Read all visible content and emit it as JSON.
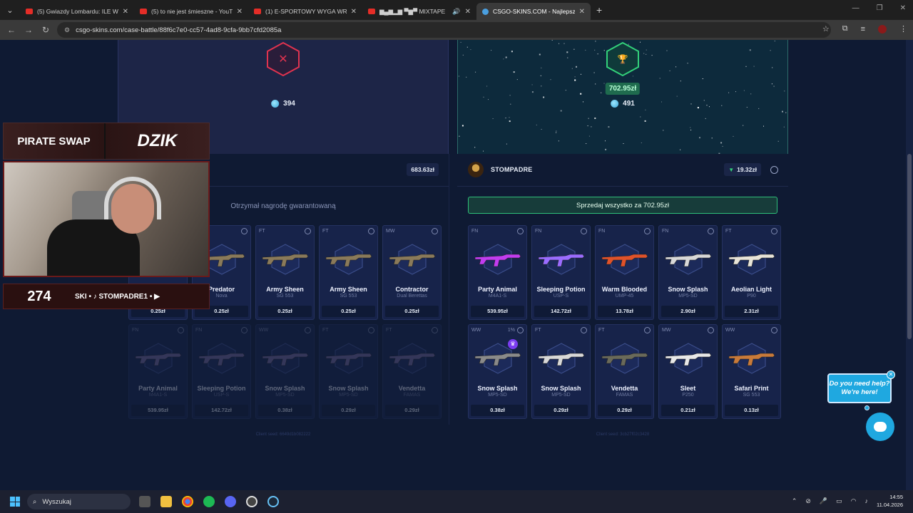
{
  "browser": {
    "tabs": [
      {
        "label": "(5) Gwiazdy Lombardu: ILE WYC",
        "icon": "youtube-icon",
        "active": false
      },
      {
        "label": "(5) to nie jest śmieszne - YouTu",
        "icon": "youtube-icon",
        "active": false
      },
      {
        "label": "(1) E-SPORTOWY WYGA WRAC",
        "icon": "youtube-icon",
        "active": false
      },
      {
        "label": "▆▄▆▂▆ ▀▆▀ MIXTAPE",
        "icon": "youtube-icon",
        "active": false
      },
      {
        "label": "CSGO-SKINS.COM - Najlepsze",
        "icon": "csgo-skins-icon",
        "active": true
      }
    ],
    "url": "csgo-skins.com/case-battle/88f6c7e0-cc57-4ad8-9cfa-9bb7cfd2085a"
  },
  "battle": {
    "left": {
      "result_icon": "x-icon",
      "coins": "394",
      "player_value": "683.63zł",
      "guaranteed_text": "Otrzymał nagrodę gwarantowaną",
      "seed": "Client seed: 6649d1b082222",
      "row1": [
        {
          "cond": "",
          "name": "",
          "type": "",
          "price": "0.25zł"
        },
        {
          "cond": "",
          "name": "Predator",
          "type": "Nova",
          "price": "0.25zł"
        },
        {
          "cond": "FT",
          "name": "Army Sheen",
          "type": "SG 553",
          "price": "0.25zł"
        },
        {
          "cond": "FT",
          "name": "Army Sheen",
          "type": "SG 553",
          "price": "0.25zł"
        },
        {
          "cond": "MW",
          "name": "Contractor",
          "type": "Dual Berettas",
          "price": "0.25zł"
        }
      ],
      "row2": [
        {
          "cond": "FN",
          "name": "Party Animal",
          "type": "M4A1-S",
          "price": "539.95zł"
        },
        {
          "cond": "FN",
          "name": "Sleeping Potion",
          "type": "USP-S",
          "price": "142.72zł"
        },
        {
          "cond": "WW",
          "name": "Snow Splash",
          "type": "MP5-SD",
          "price": "0.38zł"
        },
        {
          "cond": "FT",
          "name": "Snow Splash",
          "type": "MP5-SD",
          "price": "0.29zł"
        },
        {
          "cond": "FT",
          "name": "Vendetta",
          "type": "FAMAS",
          "price": "0.29zł"
        }
      ]
    },
    "right": {
      "result_icon": "trophy-icon",
      "won_amount": "702.95zł",
      "coins": "491",
      "player_name": "STOMPADRE",
      "player_value": "19.32zł",
      "sell_all_label": "Sprzedaj wszystko za 702.95zł",
      "seed": "Client seed: 3cb27f02c3428",
      "row1": [
        {
          "cond": "FN",
          "name": "Party Animal",
          "type": "M4A1-S",
          "price": "539.95zł",
          "color": "#c23cf0"
        },
        {
          "cond": "FN",
          "name": "Sleeping Potion",
          "type": "USP-S",
          "price": "142.72zł",
          "color": "#9a6cff"
        },
        {
          "cond": "FN",
          "name": "Warm Blooded",
          "type": "UMP-45",
          "price": "13.78zł",
          "color": "#e0522a"
        },
        {
          "cond": "FN",
          "name": "Snow Splash",
          "type": "MP5-SD",
          "price": "2.90zł",
          "color": "#d8d8d8"
        },
        {
          "cond": "FT",
          "name": "Aeolian Light",
          "type": "P90",
          "price": "2.31zł",
          "color": "#e8e4d8"
        }
      ],
      "row2": [
        {
          "cond": "WW",
          "pct": "1%",
          "name": "Snow Splash",
          "type": "MP5-SD",
          "price": "0.38zł",
          "color": "#8a8a8a"
        },
        {
          "cond": "FT",
          "name": "Snow Splash",
          "type": "MP5-SD",
          "price": "0.29zł",
          "color": "#d8d8d8"
        },
        {
          "cond": "FT",
          "name": "Vendetta",
          "type": "FAMAS",
          "price": "0.29zł",
          "color": "#6a6a5a"
        },
        {
          "cond": "MW",
          "name": "Sleet",
          "type": "P250",
          "price": "0.21zł",
          "color": "#e8e8e8"
        },
        {
          "cond": "WW",
          "name": "Safari Print",
          "type": "SG 553",
          "price": "0.13zł",
          "color": "#c87a3a"
        }
      ]
    }
  },
  "overlay": {
    "brand1": "PIRATE SWAP",
    "brand2": "DZIK",
    "sub_count": "274",
    "ticker": "SKI • ♪ STOMPADRE1 • ▶"
  },
  "chat": {
    "line1": "Do you need help?",
    "line2": "We're here!"
  },
  "taskbar": {
    "search_placeholder": "Wyszukaj",
    "time": "14:55",
    "date": "11.04.2026"
  }
}
